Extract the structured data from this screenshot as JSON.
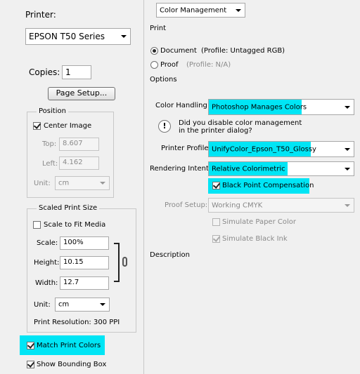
{
  "left": {
    "printer_label": "Printer:",
    "printer_value": "EPSON T50 Series",
    "copies_label": "Copies:",
    "copies_value": "1",
    "page_setup_label": "Page Setup...",
    "position": {
      "title": "Position",
      "center_image_label": "Center Image",
      "center_image_checked": true,
      "top_label": "Top:",
      "top_value": "8.607",
      "left_label": "Left:",
      "left_value": "4.162",
      "unit_label": "Unit:",
      "unit_value": "cm"
    },
    "scaled": {
      "title": "Scaled Print Size",
      "scale_to_fit_label": "Scale to Fit Media",
      "scale_to_fit_checked": false,
      "scale_label": "Scale:",
      "scale_value": "100%",
      "height_label": "Height:",
      "height_value": "10.15",
      "width_label": "Width:",
      "width_value": "12.7",
      "unit_label": "Unit:",
      "unit_value": "cm",
      "resolution": "Print Resolution: 300 PPI"
    },
    "match_print_colors_label": "Match Print Colors",
    "match_print_colors_checked": true,
    "show_bounding_box_label": "Show Bounding Box",
    "show_bounding_box_checked": true
  },
  "right": {
    "section_dropdown": "Color Management",
    "print_heading": "Print",
    "document_label": "Document",
    "document_profile": "(Profile: Untagged RGB)",
    "proof_label": "Proof",
    "proof_profile": "(Profile: N/A)",
    "options_heading": "Options",
    "color_handling_label": "Color Handling:",
    "color_handling_value": "Photoshop Manages Colors",
    "notice_line1": "Did you disable color management",
    "notice_line2": "in the printer dialog?",
    "printer_profile_label": "Printer Profile:",
    "printer_profile_value": "UnifyColor_Epson_T50_Glossy",
    "rendering_intent_label": "Rendering Intent:",
    "rendering_intent_value": "Relative Colorimetric",
    "black_point_label": "Black Point Compensation",
    "black_point_checked": true,
    "proof_setup_label": "Proof Setup:",
    "proof_setup_value": "Working CMYK",
    "simulate_paper_label": "Simulate Paper Color",
    "simulate_black_label": "Simulate Black Ink",
    "description_heading": "Description"
  },
  "colors": {
    "highlight": "#00e5f5",
    "panel_bg": "#f0f0f0"
  }
}
